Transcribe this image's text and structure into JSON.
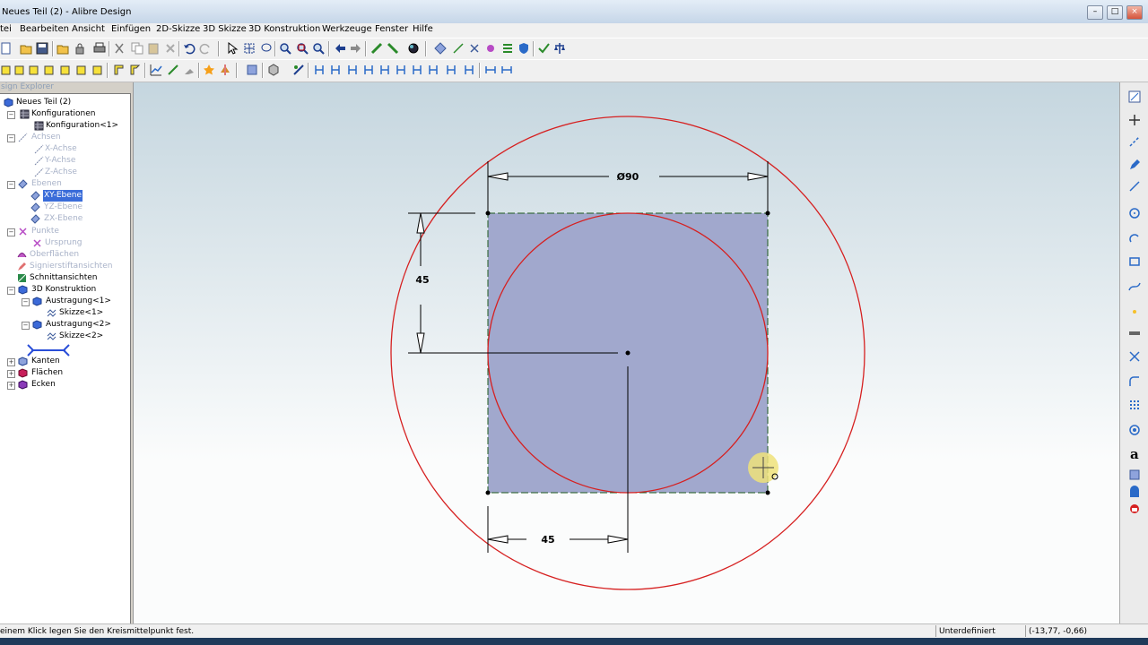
{
  "window": {
    "title": "Neues Teil (2) - Alibre Design"
  },
  "menu": [
    "tei",
    "Bearbeiten",
    "Ansicht",
    "Einfügen",
    "2D-Skizze",
    "3D Skizze",
    "3D Konstruktion",
    "Werkzeuge",
    "Fenster",
    "Hilfe"
  ],
  "explorer": {
    "title": "sign Explorer",
    "nodes": [
      {
        "label": "Neues Teil (2)",
        "icon": "part-icon"
      },
      {
        "label": "Konfigurationen",
        "icon": "config-icon"
      },
      {
        "label": "Konfiguration<1>",
        "icon": "config-icon"
      },
      {
        "label": "Achsen",
        "icon": "axis-icon"
      },
      {
        "label": "X-Achse",
        "icon": "axis-icon"
      },
      {
        "label": "Y-Achse",
        "icon": "axis-icon"
      },
      {
        "label": "Z-Achse",
        "icon": "axis-icon"
      },
      {
        "label": "Ebenen",
        "icon": "plane-icon"
      },
      {
        "label": "XY-Ebene",
        "icon": "plane-icon"
      },
      {
        "label": "YZ-Ebene",
        "icon": "plane-icon"
      },
      {
        "label": "ZX-Ebene",
        "icon": "plane-icon"
      },
      {
        "label": "Punkte",
        "icon": "point-icon"
      },
      {
        "label": "Ursprung",
        "icon": "origin-icon"
      },
      {
        "label": "Oberflächen",
        "icon": "surface-icon"
      },
      {
        "label": "Signierstiftansichten",
        "icon": "pen-icon"
      },
      {
        "label": "Schnittansichten",
        "icon": "section-icon"
      },
      {
        "label": "3D Konstruktion",
        "icon": "construction-icon"
      },
      {
        "label": "Austragung<1>",
        "icon": "extrude-icon"
      },
      {
        "label": "Skizze<1>",
        "icon": "sketch-icon"
      },
      {
        "label": "Austragung<2>",
        "icon": "extrude-icon"
      },
      {
        "label": "Skizze<2>",
        "icon": "sketch-icon"
      },
      {
        "label": "Kanten",
        "icon": "edges-icon"
      },
      {
        "label": "Flächen",
        "icon": "faces-icon"
      },
      {
        "label": "Ecken",
        "icon": "vertices-icon"
      }
    ]
  },
  "sketch": {
    "dim_diameter": "Ø90",
    "dim_vertical": "45",
    "dim_horizontal": "45"
  },
  "status": {
    "message": "einem Klick legen Sie den Kreismittelpunkt fest.",
    "state": "Unterdefiniert",
    "coords": "(-13,77, -0,66)"
  },
  "colors": {
    "sketch_line": "#d62020",
    "square_fill": "#a1a8cd",
    "selection": "#3a6cd9"
  }
}
